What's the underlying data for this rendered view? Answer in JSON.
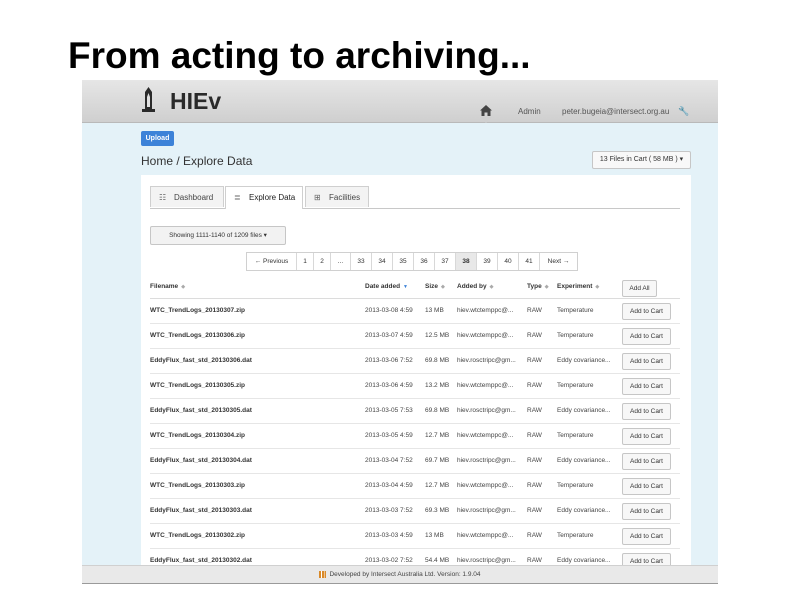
{
  "slide": {
    "title": "From acting to archiving..."
  },
  "header": {
    "brand": "HIEv",
    "nav_admin": "Admin",
    "nav_user": "peter.bugeia@intersect.org.au",
    "icons": [
      "logo-icon",
      "home-icon",
      "wrench-icon"
    ]
  },
  "upload_label": "Upload",
  "breadcrumb": "Home / Explore Data",
  "cart_button": "13 Files in Cart ( 58 MB ) ▾",
  "tabs": [
    {
      "label": "Dashboard",
      "icon": "dashboard-icon",
      "active": false
    },
    {
      "label": "Explore Data",
      "icon": "list-icon",
      "active": true
    },
    {
      "label": "Facilities",
      "icon": "facilities-icon",
      "active": false
    }
  ],
  "showing_button": "Showing 1111-1140 of 1209 files ▾",
  "pagination": {
    "prev": "← Previous",
    "pages": [
      "1",
      "2",
      "...",
      "33",
      "34",
      "35",
      "36",
      "37",
      "38",
      "39",
      "40",
      "41"
    ],
    "active": "38",
    "next": "Next →"
  },
  "table": {
    "columns": {
      "filename": "Filename",
      "date": "Date added",
      "size": "Size",
      "added_by": "Added by",
      "type": "Type",
      "experiment": "Experiment"
    },
    "add_all": "Add All",
    "add_to_cart": "Add to Cart",
    "rows": [
      {
        "filename": "WTC_TrendLogs_20130307.zip",
        "date": "2013-03-08 4:59",
        "size": "13 MB",
        "added_by": "hiev.wtctemppc@...",
        "type": "RAW",
        "experiment": "Temperature"
      },
      {
        "filename": "WTC_TrendLogs_20130306.zip",
        "date": "2013-03-07 4:59",
        "size": "12.5 MB",
        "added_by": "hiev.wtctemppc@...",
        "type": "RAW",
        "experiment": "Temperature"
      },
      {
        "filename": "EddyFlux_fast_std_20130306.dat",
        "date": "2013-03-06 7:52",
        "size": "69.8 MB",
        "added_by": "hiev.rosctripc@gm...",
        "type": "RAW",
        "experiment": "Eddy covariance..."
      },
      {
        "filename": "WTC_TrendLogs_20130305.zip",
        "date": "2013-03-06 4:59",
        "size": "13.2 MB",
        "added_by": "hiev.wtctemppc@...",
        "type": "RAW",
        "experiment": "Temperature"
      },
      {
        "filename": "EddyFlux_fast_std_20130305.dat",
        "date": "2013-03-05 7:53",
        "size": "69.8 MB",
        "added_by": "hiev.rosctripc@gm...",
        "type": "RAW",
        "experiment": "Eddy covariance..."
      },
      {
        "filename": "WTC_TrendLogs_20130304.zip",
        "date": "2013-03-05 4:59",
        "size": "12.7 MB",
        "added_by": "hiev.wtctemppc@...",
        "type": "RAW",
        "experiment": "Temperature"
      },
      {
        "filename": "EddyFlux_fast_std_20130304.dat",
        "date": "2013-03-04 7:52",
        "size": "69.7 MB",
        "added_by": "hiev.rosctripc@gm...",
        "type": "RAW",
        "experiment": "Eddy covariance..."
      },
      {
        "filename": "WTC_TrendLogs_20130303.zip",
        "date": "2013-03-04 4:59",
        "size": "12.7 MB",
        "added_by": "hiev.wtctemppc@...",
        "type": "RAW",
        "experiment": "Temperature"
      },
      {
        "filename": "EddyFlux_fast_std_20130303.dat",
        "date": "2013-03-03 7:52",
        "size": "69.3 MB",
        "added_by": "hiev.rosctripc@gm...",
        "type": "RAW",
        "experiment": "Eddy covariance..."
      },
      {
        "filename": "WTC_TrendLogs_20130302.zip",
        "date": "2013-03-03 4:59",
        "size": "13 MB",
        "added_by": "hiev.wtctemppc@...",
        "type": "RAW",
        "experiment": "Temperature"
      },
      {
        "filename": "EddyFlux_fast_std_20130302.dat",
        "date": "2013-03-02 7:52",
        "size": "54.4 MB",
        "added_by": "hiev.rosctripc@gm...",
        "type": "RAW",
        "experiment": "Eddy covariance..."
      }
    ]
  },
  "footer": "Developed by Intersect Australia Ltd. Version: 1.9.04",
  "colors": {
    "accent": "#3c82d8",
    "page_bg": "#e4f2f8",
    "topbar": "#d8d8d8"
  }
}
